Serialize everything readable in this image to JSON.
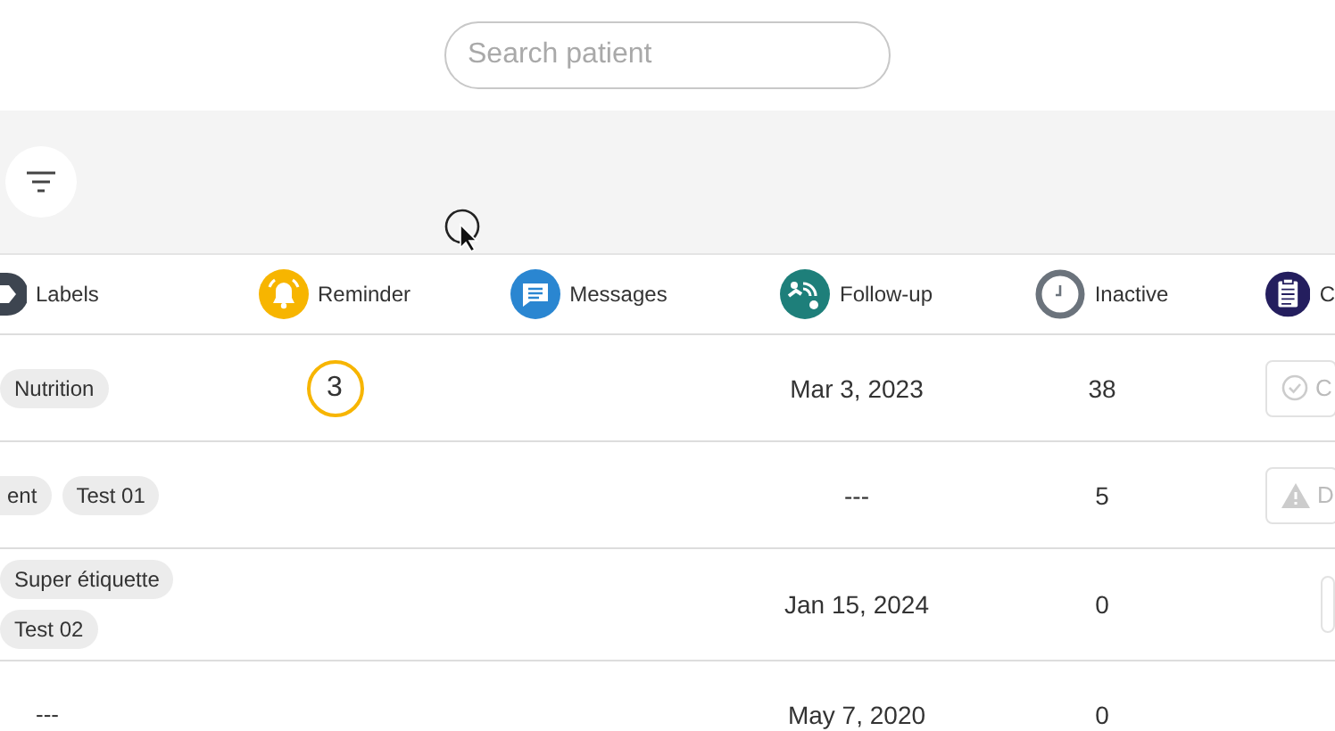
{
  "search": {
    "placeholder": "Search patient"
  },
  "columns": [
    {
      "kind": "labels",
      "label": "Labels"
    },
    {
      "kind": "reminder",
      "label": "Reminder"
    },
    {
      "kind": "messages",
      "label": "Messages"
    },
    {
      "kind": "followup",
      "label": "Follow-up"
    },
    {
      "kind": "inactive",
      "label": "Inactive"
    },
    {
      "kind": "checklist",
      "label": "C"
    }
  ],
  "rows": [
    {
      "labels": [
        "Nutrition"
      ],
      "reminder": "3",
      "follow_up": "Mar 3, 2023",
      "inactive": "38",
      "action": {
        "kind": "check",
        "text": "C"
      }
    },
    {
      "labels": [
        "ent",
        "Test 01"
      ],
      "follow_up": "---",
      "inactive": "5",
      "action": {
        "kind": "warning",
        "text": "D"
      }
    },
    {
      "labels": [
        "Super étiquette",
        "Test 02"
      ],
      "follow_up": "Jan 15, 2024",
      "inactive": "0",
      "action": {
        "kind": "blank"
      }
    },
    {
      "labels_empty": "---",
      "follow_up": "May 7, 2020",
      "inactive": "0"
    }
  ]
}
